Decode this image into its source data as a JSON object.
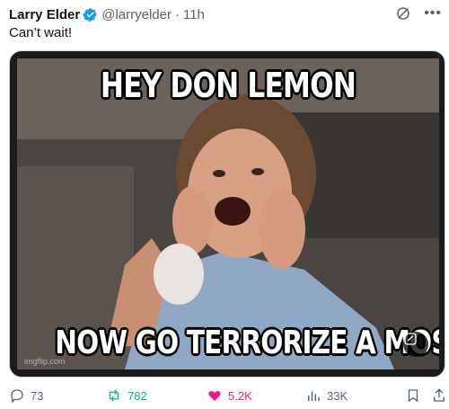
{
  "tweet": {
    "author_name": "Larry Elder",
    "handle": "@larryelder",
    "separator": "·",
    "time": "11h",
    "text": "Can’t wait!"
  },
  "media": {
    "meme_top_text": "HEY DON LEMON",
    "meme_bottom_text": "NOW GO TERRORIZE A MOSQUE",
    "watermark": "imgflip.com"
  },
  "actions": {
    "replies": "73",
    "reposts": "782",
    "likes": "5.2K",
    "views": "33K"
  },
  "colors": {
    "verified": "#1d9bf0",
    "repost_active": "#00ba7c",
    "like_active": "#f91880",
    "secondary_text": "#536471"
  }
}
